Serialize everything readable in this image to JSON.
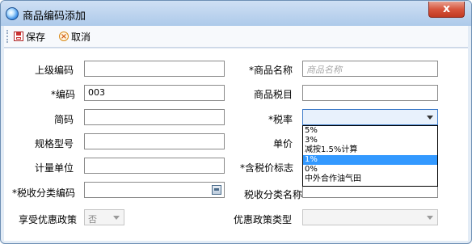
{
  "window": {
    "title": "商品编码添加",
    "close_label": "x"
  },
  "toolbar": {
    "save_label": "保存",
    "cancel_label": "取消"
  },
  "form": {
    "parent_code_label": "上级编码",
    "product_name_label": "*商品名称",
    "product_name_placeholder": "商品名称",
    "code_label": "*编码",
    "code_value": "003",
    "tax_item_label": "商品税目",
    "short_code_label": "简码",
    "tax_rate_label": "*税率",
    "spec_label": "规格型号",
    "unit_price_label": "单价",
    "unit_label": "计量单位",
    "tax_included_label": "*含税价标志",
    "tax_class_code_label": "*税收分类编码",
    "tax_class_name_label": "税收分类名称",
    "preferential_label": "享受优惠政策",
    "preferential_value": "否",
    "policy_type_label": "优惠政策类型"
  },
  "tax_rate_dropdown": {
    "options": [
      "5%",
      "3%",
      "减按1.5%计算",
      "1%",
      "0%",
      "中外合作油气田"
    ],
    "selected_index": 3
  }
}
